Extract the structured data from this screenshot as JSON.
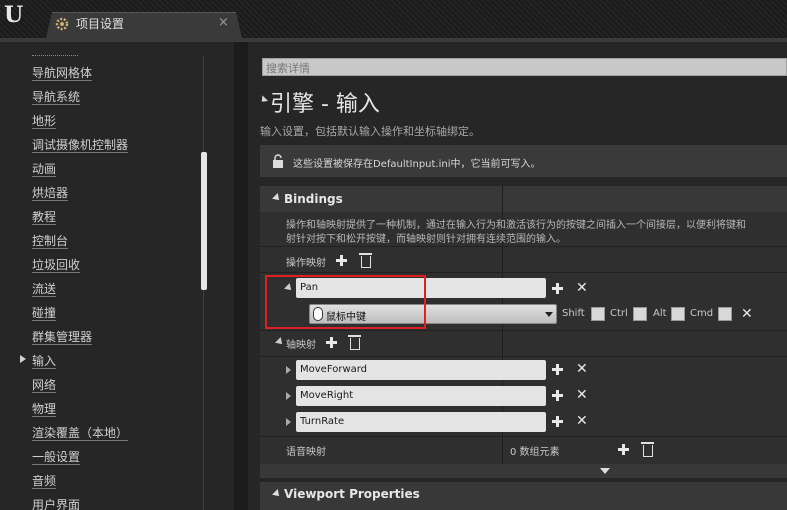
{
  "tab": {
    "title": "项目设置",
    "close": "×"
  },
  "sidebar": {
    "items": [
      "导航网格体",
      "导航系统",
      "地形",
      "调试摄像机控制器",
      "动画",
      "烘焙器",
      "教程",
      "控制台",
      "垃圾回收",
      "流送",
      "碰撞",
      "群集管理器",
      "输入",
      "网络",
      "物理",
      "渲染覆盖（本地）",
      "一般设置",
      "音频",
      "用户界面"
    ],
    "selected": "输入"
  },
  "search": {
    "placeholder": "搜索详情"
  },
  "page": {
    "title": "引擎 - 输入",
    "description": "输入设置，包括默认输入操作和坐标轴绑定。"
  },
  "notice": {
    "text": "这些设置被保存在DefaultInput.ini中，它当前可写入。"
  },
  "bindings": {
    "title": "Bindings",
    "desc1": "操作和轴映射提供了一种机制，通过在输入行为和激活该行为的按键之间插入一个间接层，以便利将键和",
    "desc2": "射针对按下和松开按键，而轴映射则针对拥有连续范围的输入。",
    "action_label": "操作映射",
    "action": {
      "name": "Pan",
      "key": "鼠标中键",
      "mods": [
        "Shift",
        "Ctrl",
        "Alt",
        "Cmd"
      ]
    },
    "axis_label": "轴映射",
    "axes": [
      "MoveForward",
      "MoveRight",
      "TurnRate"
    ],
    "voice_label": "语音映射",
    "voice_count": "0 数组元素"
  },
  "viewport": {
    "title": "Viewport Properties"
  },
  "colors": {
    "accent_highlight": "#e02020",
    "panel": "#262626"
  }
}
